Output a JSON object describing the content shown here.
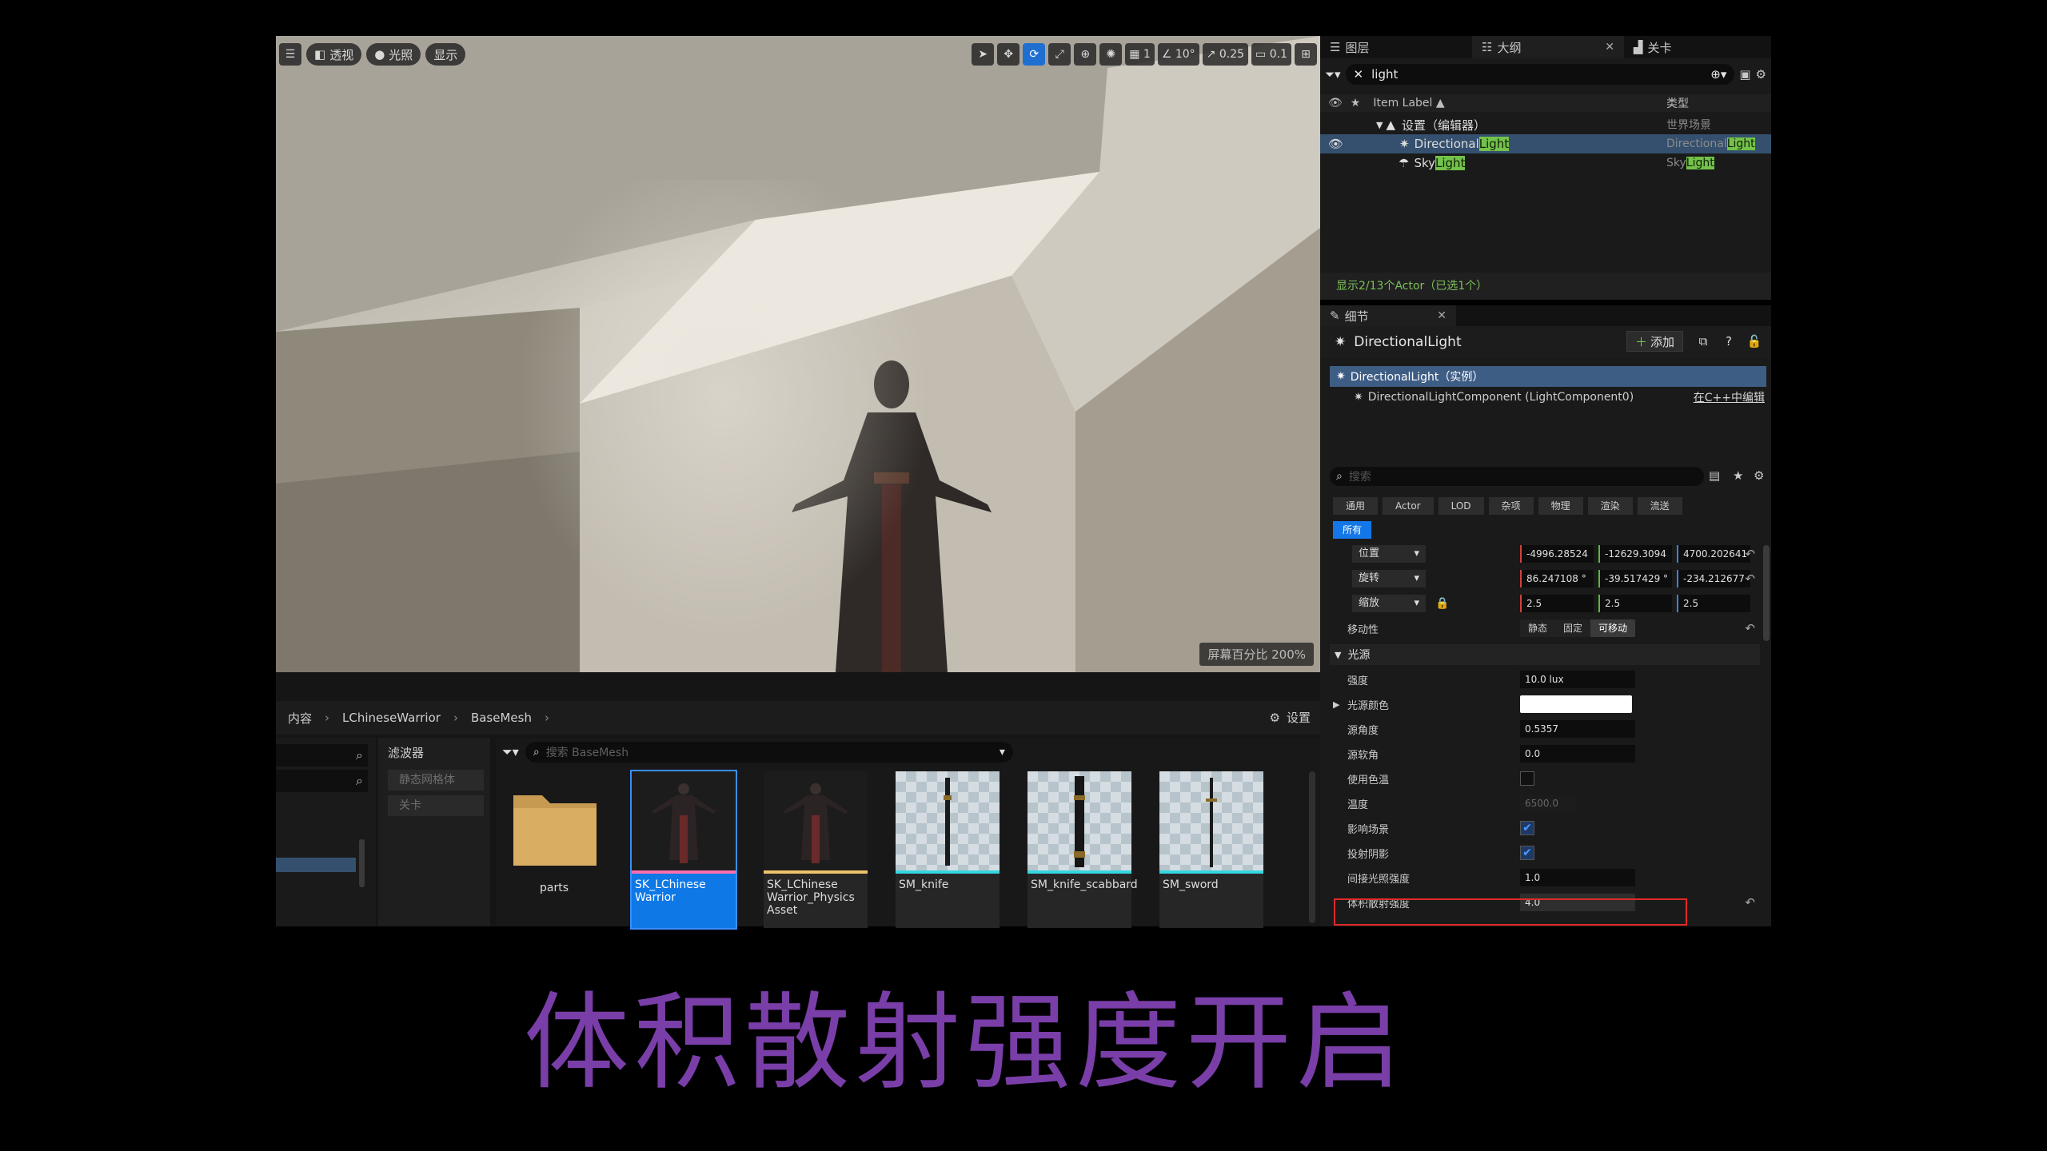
{
  "viewport": {
    "toolbar": {
      "perspective": "透视",
      "lighting": "光照",
      "show": "显示",
      "grid_snap": "1",
      "angle_snap": "10°",
      "scale_snap": "0.25",
      "camera_speed": "0.1"
    },
    "screen_percentage": "屏幕百分比 200%"
  },
  "content_browser": {
    "breadcrumb": [
      "内容",
      "LChineseWarrior",
      "BaseMesh"
    ],
    "settings_label": "设置",
    "filters_title": "滤波器",
    "filters": [
      "静态网格体",
      "关卡"
    ],
    "search_placeholder": "搜索 BaseMesh",
    "assets": [
      {
        "name": "parts",
        "kind": "folder"
      },
      {
        "name": "SK_LChinese Warrior",
        "kind": "skeletal",
        "selected": true,
        "stripe": "#ff6fb0"
      },
      {
        "name": "SK_LChinese Warrior_Physics Asset",
        "kind": "physics",
        "stripe": "#f2c36b"
      },
      {
        "name": "SM_knife",
        "kind": "static",
        "stripe": "#36d6e0"
      },
      {
        "name": "SM_knife_scabbard",
        "kind": "static",
        "stripe": "#36d6e0"
      },
      {
        "name": "SM_sword",
        "kind": "static",
        "stripe": "#36d6e0"
      }
    ]
  },
  "outliner": {
    "tabs": [
      "图层",
      "大纲",
      "关卡"
    ],
    "search_value": "light",
    "header": {
      "label": "Item Label ▲",
      "type": "类型"
    },
    "rows": [
      {
        "label": "设置（编辑器）",
        "type": "世界场景"
      },
      {
        "label_a": "Directional",
        "label_b": "Light",
        "type_a": "Directional",
        "type_b": "Light"
      },
      {
        "label_a": "Sky",
        "label_b": "Light",
        "type_a": "Sky",
        "type_b": "Light"
      }
    ],
    "status": "显示2/13个Actor（已选1个）"
  },
  "details": {
    "tab": "细节",
    "actor_name": "DirectionalLight",
    "add_label": "添加",
    "instance_row": "DirectionalLight（实例）",
    "component_row": "DirectionalLightComponent (LightComponent0)",
    "edit_in_cpp": "在C++中编辑",
    "search_placeholder": "搜索",
    "categories": [
      "通用",
      "Actor",
      "LOD",
      "杂项",
      "物理",
      "渲染",
      "流送"
    ],
    "category_all": "所有",
    "transform": {
      "location_label": "位置",
      "location": [
        "-4996.28524",
        "-12629.3094",
        "4700.202641"
      ],
      "rotation_label": "旋转",
      "rotation": [
        "86.247108 °",
        "-39.517429 °",
        "-234.212677"
      ],
      "scale_label": "缩放",
      "scale": [
        "2.5",
        "2.5",
        "2.5"
      ]
    },
    "mobility": {
      "label": "移动性",
      "options": [
        "静态",
        "固定",
        "可移动"
      ],
      "selected": "可移动"
    },
    "light_section": "光源",
    "props": {
      "intensity": {
        "label": "强度",
        "value": "10.0 lux"
      },
      "light_color": {
        "label": "光源颜色"
      },
      "source_angle": {
        "label": "源角度",
        "value": "0.5357"
      },
      "source_soft_angle": {
        "label": "源软角",
        "value": "0.0"
      },
      "use_temperature": {
        "label": "使用色温"
      },
      "temperature": {
        "label": "温度",
        "value": "6500.0"
      },
      "affects_world": {
        "label": "影响场景"
      },
      "cast_shadows": {
        "label": "投射阴影"
      },
      "indirect_intensity": {
        "label": "间接光照强度",
        "value": "1.0"
      },
      "volumetric_scattering": {
        "label": "体积散射强度",
        "value": "4.0"
      }
    }
  },
  "caption": "体积散射强度开启",
  "colors": {
    "accent": "#1477e8",
    "caption": "#7a3ea8",
    "highlight": "#73c24a",
    "redbox": "#e02a2a"
  }
}
